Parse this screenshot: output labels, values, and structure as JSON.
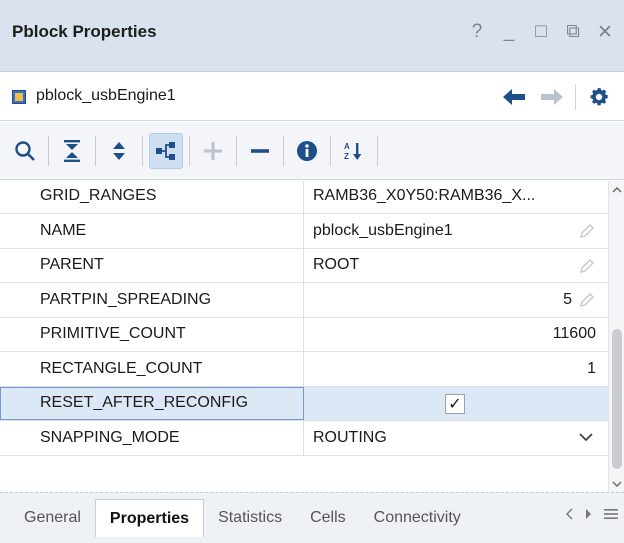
{
  "window": {
    "title": "Pblock Properties",
    "controls": [
      "?",
      "_",
      "□",
      "⧉",
      "✕"
    ]
  },
  "object": {
    "name": "pblock_usbEngine1",
    "icon": "pblock-icon"
  },
  "toolbar": {
    "buttons": [
      "search-icon",
      "collapse-all-icon",
      "expand-all-icon",
      "group-icon",
      "add-icon",
      "remove-icon",
      "info-icon",
      "sort-icon"
    ]
  },
  "properties": {
    "rows": [
      {
        "key": "GRID_RANGES",
        "value": "RAMB36_X0Y50:RAMB36_X..."
      },
      {
        "key": "NAME",
        "value": "pblock_usbEngine1"
      },
      {
        "key": "PARENT",
        "value": "ROOT"
      },
      {
        "key": "PARTPIN_SPREADING",
        "value": "5"
      },
      {
        "key": "PRIMITIVE_COUNT",
        "value": "11600"
      },
      {
        "key": "RECTANGLE_COUNT",
        "value": "1"
      },
      {
        "key": "RESET_AFTER_RECONFIG",
        "value": "✓"
      },
      {
        "key": "SNAPPING_MODE",
        "value": "ROUTING"
      }
    ]
  },
  "tabs": [
    "General",
    "Properties",
    "Statistics",
    "Cells",
    "Connectivity"
  ],
  "active_tab": "Properties",
  "colors": {
    "titlebar": "#d9e2ee",
    "selected_row": "#dde8f7",
    "accent": "#1f4f8a"
  }
}
